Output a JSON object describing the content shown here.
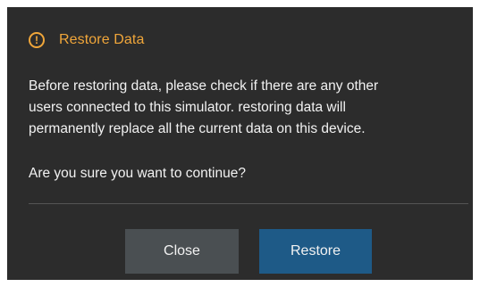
{
  "dialog": {
    "icon": "warning-circle-icon",
    "icon_glyph": "!",
    "title": "Restore Data",
    "message_lines": [
      "Before restoring data, please check if there are any other",
      "users connected to this simulator. restoring data will",
      "permanently replace all the current data on this device."
    ],
    "question": "Are you sure you want to continue?",
    "close_label": "Close",
    "restore_label": "Restore"
  },
  "colors": {
    "background": "#2c2c2c",
    "title_accent": "#f0a63a",
    "text": "#f2f2f2",
    "divider": "#555555",
    "close_button": "#4a4f52",
    "restore_button": "#1e5a87"
  }
}
